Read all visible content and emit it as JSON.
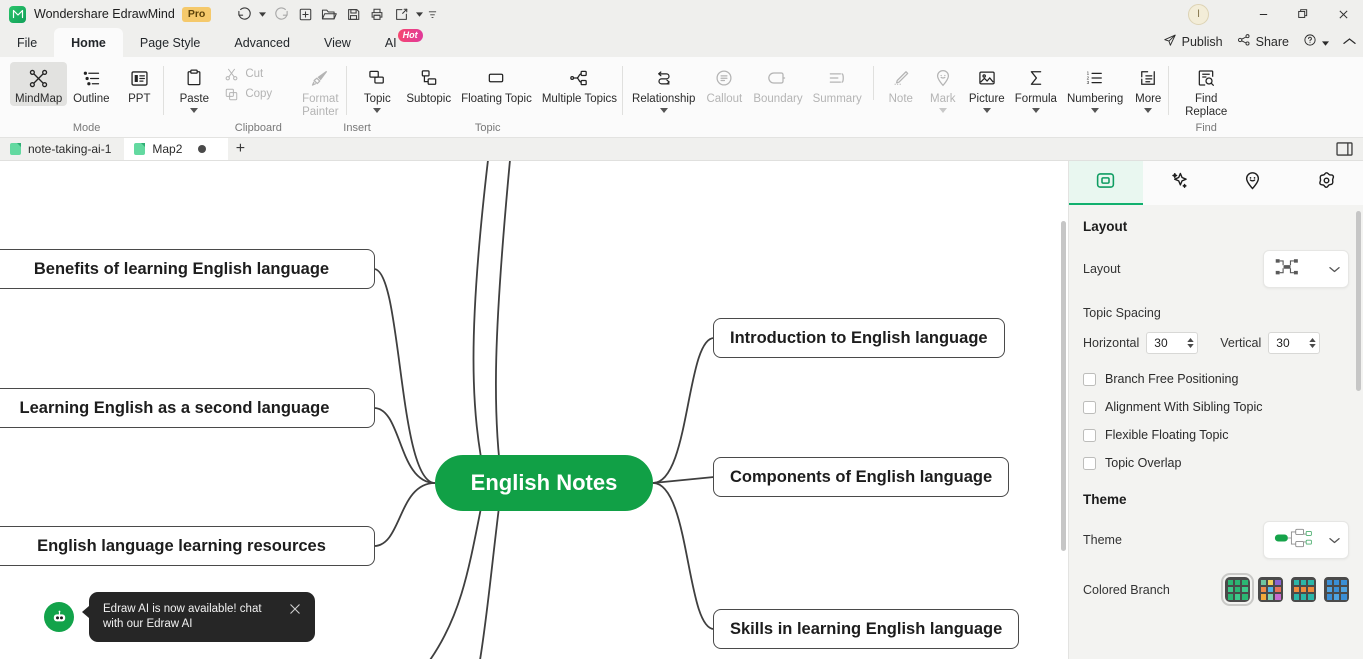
{
  "titlebar": {
    "app_name": "Wondershare EdrawMind",
    "edition_badge": "Pro",
    "quick_access": [
      {
        "name": "undo-icon",
        "tooltip": "Undo"
      },
      {
        "name": "redo-icon",
        "tooltip": "Redo"
      },
      {
        "name": "new-icon",
        "tooltip": "New"
      },
      {
        "name": "open-icon",
        "tooltip": "Open"
      },
      {
        "name": "save-icon",
        "tooltip": "Save"
      },
      {
        "name": "print-icon",
        "tooltip": "Print"
      },
      {
        "name": "export-icon",
        "tooltip": "Export"
      }
    ],
    "avatar_initial": "I",
    "window_controls": [
      "minimize",
      "maximize",
      "close"
    ]
  },
  "menubar": {
    "tabs": [
      {
        "label": "File",
        "active": false
      },
      {
        "label": "Home",
        "active": true
      },
      {
        "label": "Page Style",
        "active": false
      },
      {
        "label": "Advanced",
        "active": false
      },
      {
        "label": "View",
        "active": false
      },
      {
        "label": "AI",
        "active": false,
        "badge": "Hot"
      }
    ],
    "right_actions": [
      {
        "label": "Publish",
        "icon": "publish-icon"
      },
      {
        "label": "Share",
        "icon": "share-icon"
      },
      {
        "label": "",
        "icon": "help-icon"
      },
      {
        "label": "",
        "icon": "collapse-ribbon-icon"
      }
    ]
  },
  "ribbon": {
    "groups": [
      {
        "name": "Mode",
        "label": "Mode",
        "buttons": [
          {
            "label": "MindMap",
            "icon": "mindmap-icon",
            "selected": true,
            "disabled": false
          },
          {
            "label": "Outline",
            "icon": "outline-icon",
            "selected": false,
            "disabled": false
          },
          {
            "label": "PPT",
            "icon": "ppt-icon",
            "selected": false,
            "disabled": false
          }
        ]
      },
      {
        "name": "Clipboard",
        "label": "Clipboard",
        "buttons": [
          {
            "label": "Paste",
            "icon": "paste-icon",
            "has_caret": true,
            "disabled": false
          }
        ],
        "rows": [
          {
            "label": "Cut",
            "icon": "cut-icon",
            "disabled": true
          },
          {
            "label": "Copy",
            "icon": "copy-icon",
            "disabled": true
          },
          {
            "label": "Format Painter",
            "icon": "format-painter-icon",
            "disabled": true
          }
        ]
      },
      {
        "name": "Topic",
        "label": "Topic",
        "buttons": [
          {
            "label": "Topic",
            "icon": "topic-icon",
            "has_caret": true,
            "disabled": false
          },
          {
            "label": "Subtopic",
            "icon": "subtopic-icon",
            "disabled": false
          },
          {
            "label": "Floating Topic",
            "icon": "floating-topic-icon",
            "disabled": false
          },
          {
            "label": "Multiple Topics",
            "icon": "multiple-topics-icon",
            "disabled": false
          }
        ]
      },
      {
        "name": "Insert",
        "label": "Insert",
        "buttons": [
          {
            "label": "Relationship",
            "icon": "relationship-icon",
            "has_caret": true,
            "disabled": false
          },
          {
            "label": "Callout",
            "icon": "callout-icon",
            "disabled": true
          },
          {
            "label": "Boundary",
            "icon": "boundary-icon",
            "disabled": true
          },
          {
            "label": "Summary",
            "icon": "summary-icon",
            "disabled": true
          },
          {
            "label": "Note",
            "icon": "note-icon",
            "disabled": true
          },
          {
            "label": "Mark",
            "icon": "mark-icon",
            "has_caret": true,
            "disabled": true
          },
          {
            "label": "Picture",
            "icon": "picture-icon",
            "has_caret": true,
            "disabled": false
          },
          {
            "label": "Formula",
            "icon": "formula-icon",
            "has_caret": true,
            "disabled": false
          },
          {
            "label": "Numbering",
            "icon": "numbering-icon",
            "has_caret": true,
            "disabled": false
          },
          {
            "label": "More",
            "icon": "more-icon",
            "has_caret": true,
            "disabled": false
          }
        ]
      },
      {
        "name": "Find",
        "label": "Find",
        "buttons": [
          {
            "label": "Find Replace",
            "icon": "find-replace-icon",
            "disabled": false
          }
        ]
      }
    ]
  },
  "tabstrip": {
    "documents": [
      {
        "label": "note-taking-ai-1",
        "active": false,
        "dirty": false
      },
      {
        "label": "Map2",
        "active": true,
        "dirty": true
      }
    ],
    "new_tab_label": "+",
    "panel_toggle_icon": "panel-toggle-icon"
  },
  "canvas": {
    "center_topic": "English Notes",
    "center_color": "#11a046",
    "right_topics": [
      {
        "label": "Introduction to English language"
      },
      {
        "label": "Components of English language"
      },
      {
        "label": "Skills in learning English language"
      }
    ],
    "left_topics": [
      {
        "label": "Benefits of learning English language"
      },
      {
        "label": "Learning English as a second language"
      },
      {
        "label": "English language learning resources"
      }
    ]
  },
  "toast": {
    "icon": "edraw-ai-bot-icon",
    "message": "Edraw AI is now available!  chat with our Edraw AI",
    "close_icon": "close-icon"
  },
  "right_panel": {
    "tabs": [
      {
        "name": "layout-tab",
        "icon": "layout-panel-icon",
        "active": true
      },
      {
        "name": "style-tab",
        "icon": "sparkle-icon",
        "active": false
      },
      {
        "name": "clipart-tab",
        "icon": "smiley-pin-icon",
        "active": false
      },
      {
        "name": "settings-tab",
        "icon": "gear-flower-icon",
        "active": false
      }
    ],
    "layout_section": {
      "heading": "Layout",
      "layout_label": "Layout",
      "layout_value_icon": "radial-layout-icon",
      "topic_spacing_label": "Topic Spacing",
      "horizontal_label": "Horizontal",
      "horizontal_value": "30",
      "vertical_label": "Vertical",
      "vertical_value": "30",
      "checkboxes": [
        {
          "label": "Branch Free Positioning",
          "checked": false
        },
        {
          "label": "Alignment With Sibling Topic",
          "checked": false
        },
        {
          "label": "Flexible Floating Topic",
          "checked": false
        },
        {
          "label": "Topic Overlap",
          "checked": false
        }
      ]
    },
    "theme_section": {
      "heading": "Theme",
      "theme_label": "Theme",
      "theme_preview_icon": "theme-preview-icon",
      "colored_branch_label": "Colored Branch",
      "swatches": [
        {
          "name": "green-palette",
          "selected": true,
          "colors": [
            "#2bb673",
            "#2bb673",
            "#2bb673",
            "#3cc98a",
            "#2bb673",
            "#3cc98a",
            "#2bb673",
            "#3cc98a",
            "#2bb673"
          ]
        },
        {
          "name": "multicolor-palette",
          "selected": false,
          "colors": [
            "#6dc5a0",
            "#f0d15a",
            "#8a63d2",
            "#ef8b4a",
            "#4fb3e8",
            "#e8725a",
            "#f2a93b",
            "#7ed3b0",
            "#c76bd0"
          ]
        },
        {
          "name": "teal-orange-palette",
          "selected": false,
          "colors": [
            "#2bb6a8",
            "#2bb6a8",
            "#2bb6a8",
            "#ef8b3c",
            "#ef8b3c",
            "#ef8b3c",
            "#2bb6a8",
            "#2bb6a8",
            "#2bb6a8"
          ]
        },
        {
          "name": "blue-palette",
          "selected": false,
          "colors": [
            "#3a8fd6",
            "#3a8fd6",
            "#3a8fd6",
            "#4fa3e0",
            "#3a8fd6",
            "#4fa3e0",
            "#3a8fd6",
            "#4fa3e0",
            "#3a8fd6"
          ]
        }
      ]
    }
  }
}
